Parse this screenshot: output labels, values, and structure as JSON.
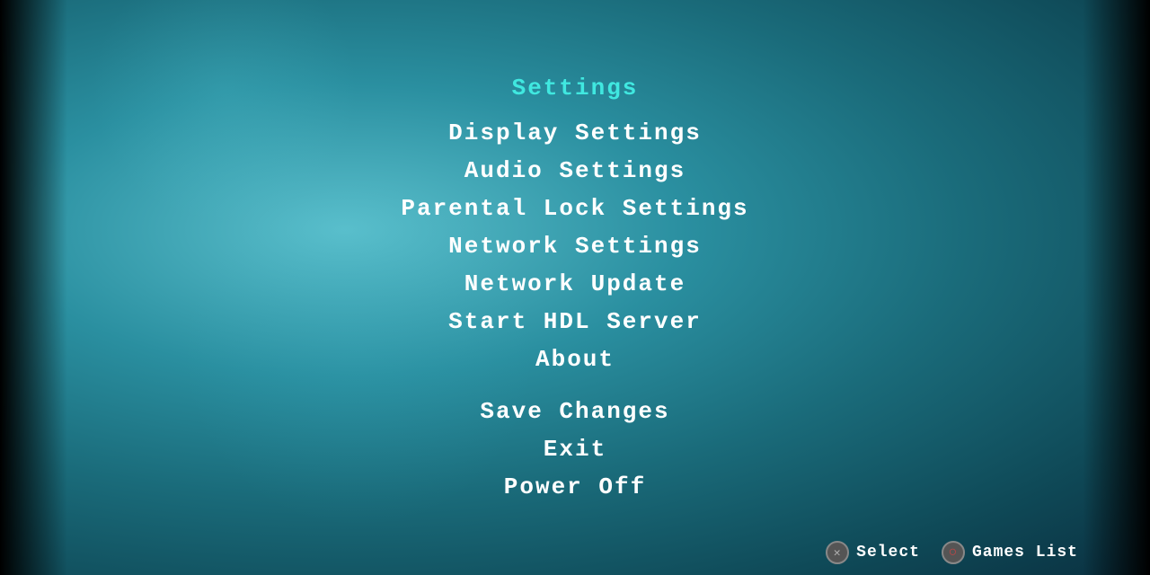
{
  "menu": {
    "title": "Settings",
    "items": [
      {
        "label": "Display  Settings",
        "id": "display-settings"
      },
      {
        "label": "Audio  Settings",
        "id": "audio-settings"
      },
      {
        "label": "Parental  Lock  Settings",
        "id": "parental-lock"
      },
      {
        "label": "Network  Settings",
        "id": "network-settings"
      },
      {
        "label": "Network  Update",
        "id": "network-update"
      },
      {
        "label": "Start  HDL  Server",
        "id": "start-hdl-server"
      },
      {
        "label": "About",
        "id": "about"
      }
    ],
    "actions": [
      {
        "label": "Save  Changes",
        "id": "save-changes"
      },
      {
        "label": "Exit",
        "id": "exit"
      },
      {
        "label": "Power  Off",
        "id": "power-off"
      }
    ]
  },
  "controls": {
    "select_label": "Select",
    "games_list_label": "Games List"
  },
  "colors": {
    "title": "#40e8e0",
    "menu_item": "#ffffff",
    "cross_btn": "#888888",
    "circle_btn": "#cc4444"
  }
}
